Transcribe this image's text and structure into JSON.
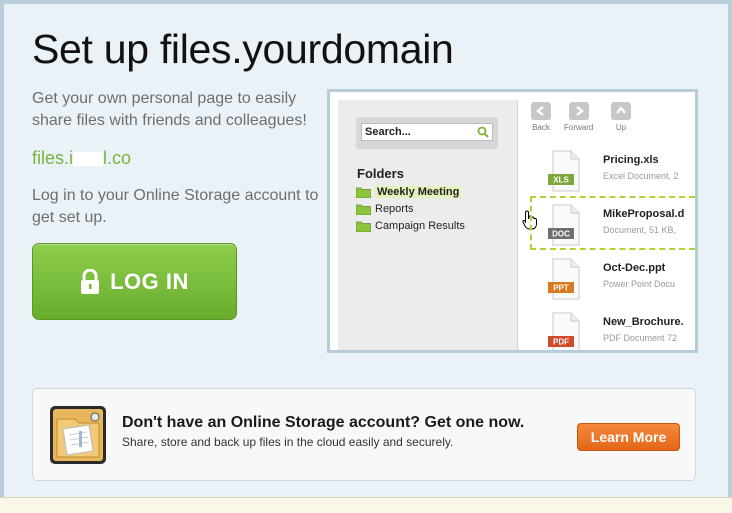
{
  "page": {
    "title": "Set up files.yourdomain",
    "intro": "Get your own personal page to easily share files with friends and colleagues!",
    "domain_prefix": "files.i",
    "domain_suffix": "l.co",
    "login_prompt": "Log in to your Online Storage account to get set up.",
    "login_button": "LOG IN"
  },
  "preview": {
    "search_placeholder": "Search...",
    "folders_heading": "Folders",
    "folders": [
      {
        "label": "Weekly Meeting",
        "selected": true
      },
      {
        "label": "Reports",
        "selected": false
      },
      {
        "label": "Campaign Results",
        "selected": false
      }
    ],
    "nav": [
      {
        "label": "Back",
        "icon": "arrow-left-icon"
      },
      {
        "label": "Forward",
        "icon": "arrow-right-icon"
      },
      {
        "label": "Up",
        "icon": "arrow-up-icon"
      }
    ],
    "files": [
      {
        "name": "Pricing.xls",
        "meta": "Excel Document, 2",
        "badge": "XLS",
        "badge_color": "#7aa83a"
      },
      {
        "name": "MikeProposal.d",
        "meta": "Document, 51 KB,",
        "badge": "DOC",
        "badge_color": "#6f6f6f"
      },
      {
        "name": "Oct-Dec.ppt",
        "meta": "Power Point Docu",
        "badge": "PPT",
        "badge_color": "#d9791f"
      },
      {
        "name": "New_Brochure.",
        "meta": "PDF Document 72",
        "badge": "PDF",
        "badge_color": "#d04a2a"
      }
    ]
  },
  "promo": {
    "heading": "Don't have an Online Storage account? Get one now.",
    "subtext": "Share, store and back up files in the cloud easily and securely.",
    "button": "Learn More"
  },
  "colors": {
    "accent_green": "#78b33a",
    "button_orange": "#e26617"
  }
}
